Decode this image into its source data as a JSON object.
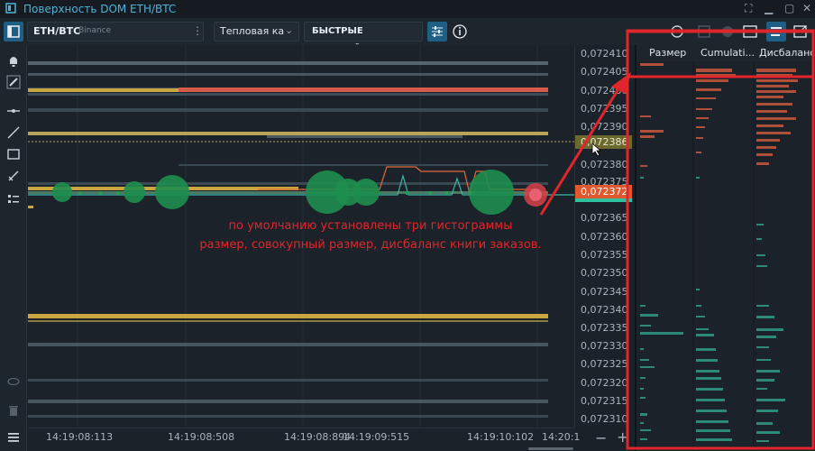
{
  "window": {
    "title": "Поверхность DOM ETH/BTC"
  },
  "toolbar": {
    "symbol": "ETH/BTC",
    "exchange": "Binance",
    "mode_select": "Тепловая ка",
    "quick_settings": "БЫСТРЫЕ НАСТРОЙКИ"
  },
  "price_axis": {
    "labels": [
      "0,072410",
      "0,072405",
      "0,072400",
      "0,072395",
      "0,072390",
      "0,072385",
      "0,072380",
      "0,072375",
      "0,072370",
      "0,072365",
      "0,072360",
      "0,072355",
      "0,072350",
      "0,072345",
      "0,072340",
      "0,072335",
      "0,072330",
      "0,072325",
      "0,072320",
      "0,072315",
      "0,072310"
    ],
    "marker_ask": "0,072386",
    "marker_bid": "0,072372"
  },
  "time_axis": {
    "labels": [
      "14:19:08:113",
      "14:19:08:508",
      "14:19:08:894",
      "14:19:09:515",
      "14:19:10:102",
      "14:20:1"
    ]
  },
  "histograms": {
    "headers": [
      "Размер",
      "Cumulati...",
      "Дисбаланс"
    ]
  },
  "annotation": {
    "line1": "по умолчанию установлены три гистограммы",
    "line2": "размер, совокупный размер, дисбаланс книги заказов."
  },
  "colors": {
    "accent": "#4fb3d9",
    "bid": "#26a06a",
    "ask": "#e05a3a",
    "highlight": "#e0262b",
    "level_gold": "#c9a640"
  }
}
